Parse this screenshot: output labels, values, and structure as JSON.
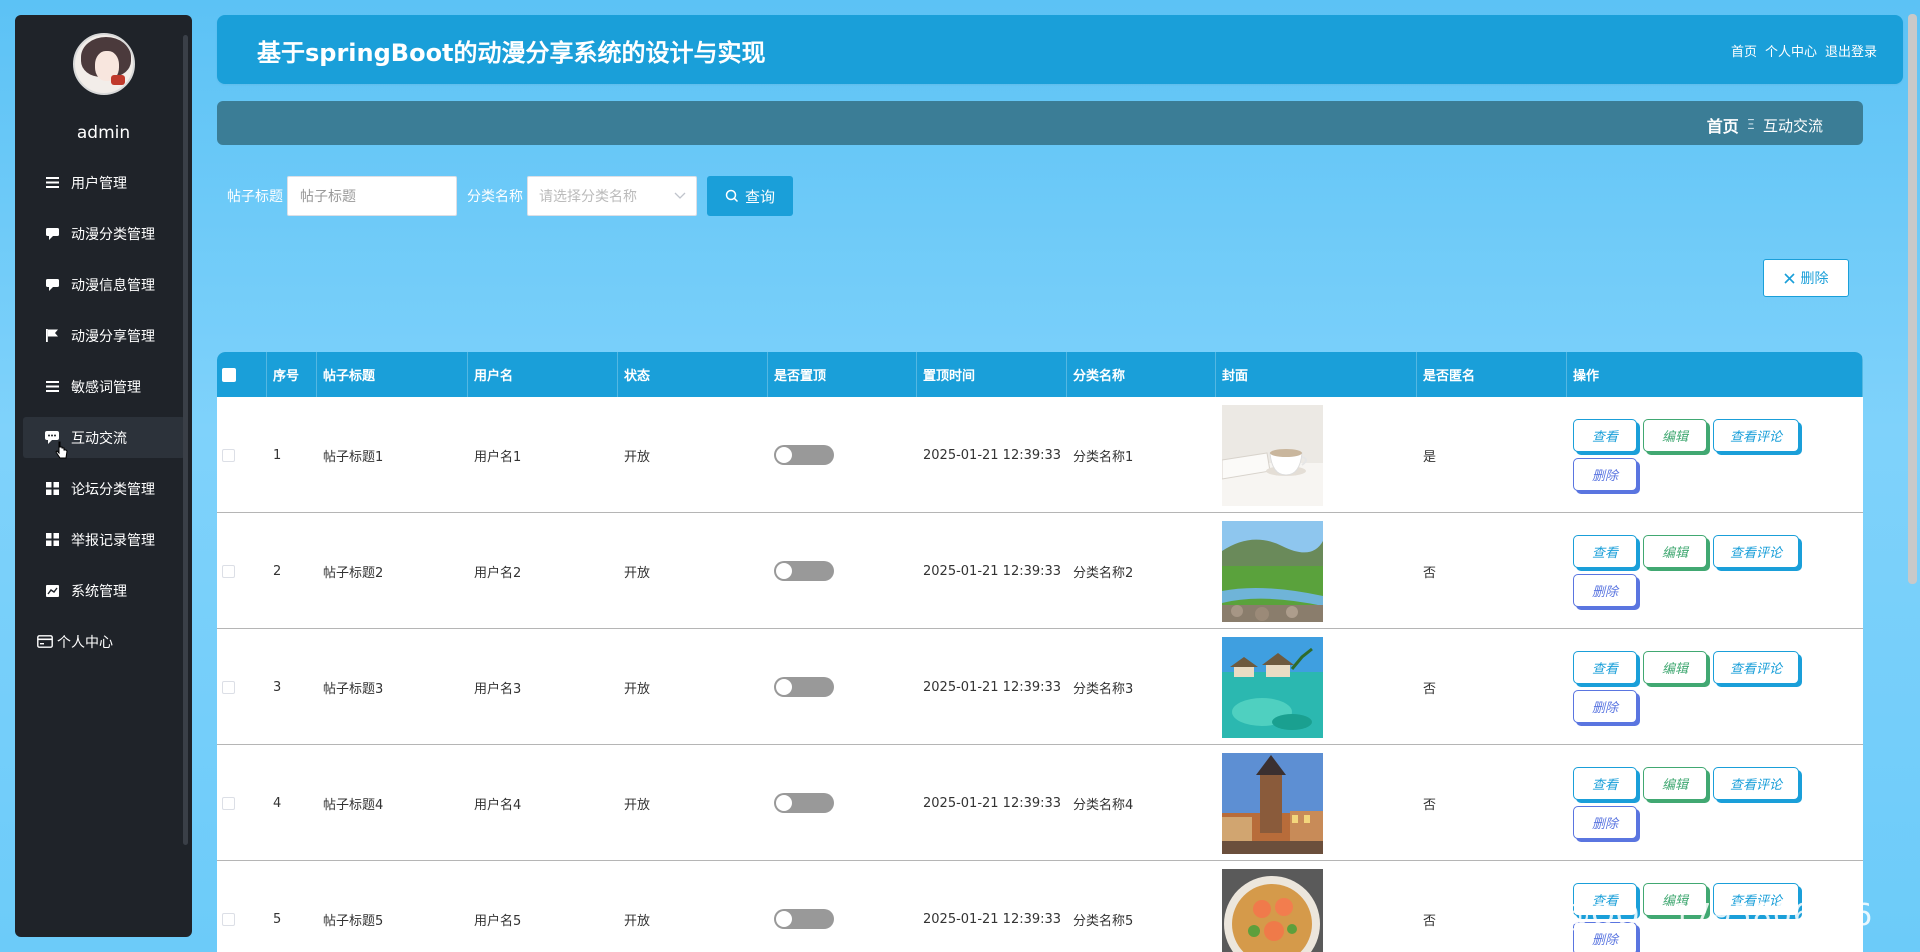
{
  "app": {
    "title": "基于springBoot的动漫分享系统的设计与实现",
    "header_links": [
      "首页",
      "个人中心",
      "退出登录"
    ]
  },
  "user": {
    "name": "admin"
  },
  "sidebar": {
    "items": [
      {
        "label": "用户管理",
        "icon": "list-icon"
      },
      {
        "label": "动漫分类管理",
        "icon": "comment-icon"
      },
      {
        "label": "动漫信息管理",
        "icon": "comment-icon"
      },
      {
        "label": "动漫分享管理",
        "icon": "flag-icon"
      },
      {
        "label": "敏感词管理",
        "icon": "list-icon"
      },
      {
        "label": "互动交流",
        "icon": "chat-icon",
        "active": true
      },
      {
        "label": "论坛分类管理",
        "icon": "grid-icon"
      },
      {
        "label": "举报记录管理",
        "icon": "grid-icon"
      },
      {
        "label": "系统管理",
        "icon": "chart-icon"
      }
    ],
    "personal": {
      "label": "个人中心",
      "icon": "card-icon"
    }
  },
  "breadcrumb": {
    "home": "首页",
    "separator": "Ξ",
    "current": "互动交流"
  },
  "search": {
    "title_label": "帖子标题",
    "title_placeholder": "帖子标题",
    "category_label": "分类名称",
    "category_placeholder": "请选择分类名称",
    "query_label": "查询"
  },
  "toolbar": {
    "delete_label": "删除"
  },
  "table": {
    "columns": [
      "序号",
      "帖子标题",
      "用户名",
      "状态",
      "是否置顶",
      "置顶时间",
      "分类名称",
      "封面",
      "是否匿名",
      "操作"
    ],
    "actions": {
      "view": "查看",
      "edit": "编辑",
      "comments": "查看评论",
      "delete": "删除"
    },
    "rows": [
      {
        "idx": "1",
        "title": "帖子标题1",
        "user": "用户名1",
        "status": "开放",
        "time": "2025-01-21 12:39:33",
        "category": "分类名称1",
        "anon": "是",
        "cover": "cup"
      },
      {
        "idx": "2",
        "title": "帖子标题2",
        "user": "用户名2",
        "status": "开放",
        "time": "2025-01-21 12:39:33",
        "category": "分类名称2",
        "anon": "否",
        "cover": "meadow"
      },
      {
        "idx": "3",
        "title": "帖子标题3",
        "user": "用户名3",
        "status": "开放",
        "time": "2025-01-21 12:39:33",
        "category": "分类名称3",
        "anon": "否",
        "cover": "lagoon"
      },
      {
        "idx": "4",
        "title": "帖子标题4",
        "user": "用户名4",
        "status": "开放",
        "time": "2025-01-21 12:39:33",
        "category": "分类名称4",
        "anon": "否",
        "cover": "tower"
      },
      {
        "idx": "5",
        "title": "帖子标题5",
        "user": "用户名5",
        "status": "开放",
        "time": "2025-01-21 12:39:33",
        "category": "分类名称5",
        "anon": "否",
        "cover": "food"
      }
    ]
  },
  "watermark": "CSDN @QQ__1795806396",
  "colors": {
    "primary": "#1a9fd9",
    "sidebar": "#1f2329",
    "crumbbar": "#3b7d96",
    "edit": "#41a872",
    "delete": "#5a75e0"
  }
}
